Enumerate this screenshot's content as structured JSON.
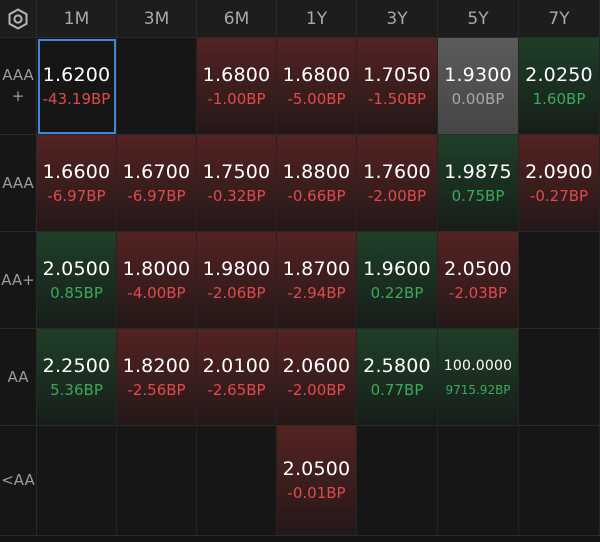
{
  "columns": [
    "1M",
    "3M",
    "6M",
    "1Y",
    "3Y",
    "5Y",
    "7Y"
  ],
  "settings_icon": "gear-hexagon-icon",
  "rows": [
    {
      "label": "AAA\n+",
      "cells": [
        {
          "value": "1.6200",
          "change": "-43.19BP",
          "tone": "none",
          "sign": "neg",
          "selected": true
        },
        null,
        {
          "value": "1.6800",
          "change": "-1.00BP",
          "tone": "red",
          "sign": "neg"
        },
        {
          "value": "1.6800",
          "change": "-5.00BP",
          "tone": "red",
          "sign": "neg"
        },
        {
          "value": "1.7050",
          "change": "-1.50BP",
          "tone": "red",
          "sign": "neg"
        },
        {
          "value": "1.9300",
          "change": "0.00BP",
          "tone": "gray",
          "sign": "zero"
        },
        {
          "value": "2.0250",
          "change": "1.60BP",
          "tone": "green",
          "sign": "pos"
        }
      ]
    },
    {
      "label": "AAA",
      "cells": [
        {
          "value": "1.6600",
          "change": "-6.97BP",
          "tone": "red",
          "sign": "neg"
        },
        {
          "value": "1.6700",
          "change": "-6.97BP",
          "tone": "red",
          "sign": "neg"
        },
        {
          "value": "1.7500",
          "change": "-0.32BP",
          "tone": "red",
          "sign": "neg"
        },
        {
          "value": "1.8800",
          "change": "-0.66BP",
          "tone": "red",
          "sign": "neg"
        },
        {
          "value": "1.7600",
          "change": "-2.00BP",
          "tone": "red",
          "sign": "neg"
        },
        {
          "value": "1.9875",
          "change": "0.75BP",
          "tone": "green",
          "sign": "pos"
        },
        {
          "value": "2.0900",
          "change": "-0.27BP",
          "tone": "red",
          "sign": "neg"
        }
      ]
    },
    {
      "label": "AA+",
      "cells": [
        {
          "value": "2.0500",
          "change": "0.85BP",
          "tone": "green",
          "sign": "pos"
        },
        {
          "value": "1.8000",
          "change": "-4.00BP",
          "tone": "red",
          "sign": "neg"
        },
        {
          "value": "1.9800",
          "change": "-2.06BP",
          "tone": "red",
          "sign": "neg"
        },
        {
          "value": "1.8700",
          "change": "-2.94BP",
          "tone": "red",
          "sign": "neg"
        },
        {
          "value": "1.9600",
          "change": "0.22BP",
          "tone": "green",
          "sign": "pos"
        },
        {
          "value": "2.0500",
          "change": "-2.03BP",
          "tone": "red",
          "sign": "neg"
        },
        null
      ]
    },
    {
      "label": "AA",
      "cells": [
        {
          "value": "2.2500",
          "change": "5.36BP",
          "tone": "green",
          "sign": "pos"
        },
        {
          "value": "1.8200",
          "change": "-2.56BP",
          "tone": "red",
          "sign": "neg"
        },
        {
          "value": "2.0100",
          "change": "-2.65BP",
          "tone": "red",
          "sign": "neg"
        },
        {
          "value": "2.0600",
          "change": "-2.00BP",
          "tone": "red",
          "sign": "neg"
        },
        {
          "value": "2.5800",
          "change": "0.77BP",
          "tone": "green",
          "sign": "pos"
        },
        {
          "value": "100.0000",
          "change": "9715.92BP",
          "tone": "green",
          "sign": "pos",
          "small": true
        },
        null
      ]
    },
    {
      "label": "<AA",
      "cells": [
        null,
        null,
        null,
        {
          "value": "2.0500",
          "change": "-0.01BP",
          "tone": "red",
          "sign": "neg"
        },
        null,
        null,
        null
      ]
    }
  ]
}
